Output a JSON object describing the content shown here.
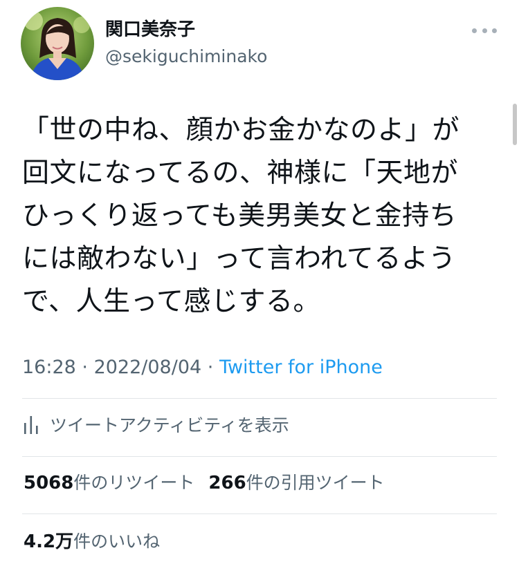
{
  "profile": {
    "display_name": "関口美奈子",
    "handle": "@sekiguchiminako"
  },
  "tweet": {
    "text": "「世の中ね、顔かお金かなのよ」が\n回文になってるの、神様に「天地が\nひっくり返っても美男美女と金持ち\nには敵わない」って言われてるよう\nで、人生って感じする。"
  },
  "meta": {
    "time": "16:28",
    "separator1": " · ",
    "date": "2022/08/04",
    "separator2": " · ",
    "source": "Twitter for iPhone"
  },
  "activity": {
    "label": "ツイートアクティビティを表示",
    "icon": "bar-chart-icon"
  },
  "stats": {
    "retweets_count": "5068",
    "retweets_label": "件のリツイート",
    "quotes_count": "266",
    "quotes_label": "件の引用ツイート",
    "likes_count": "4.2万",
    "likes_label": "件のいいね"
  },
  "colors": {
    "text": "#0f1419",
    "secondary": "#536471",
    "link": "#1d9bf0",
    "divider": "#e1e5e8"
  }
}
